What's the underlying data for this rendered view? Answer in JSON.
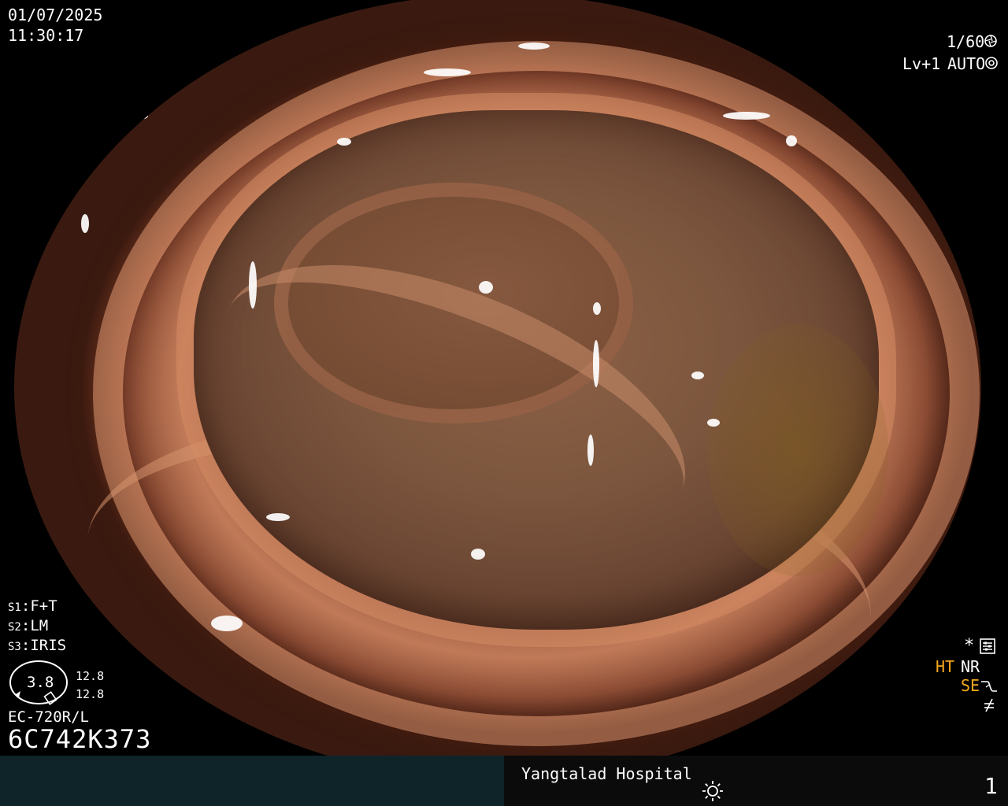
{
  "overlay": {
    "date": "01/07/2025",
    "time": "11:30:17",
    "shutter_speed": "1/60",
    "level": "Lv+1",
    "exposure_mode": "AUTO"
  },
  "scope_settings": {
    "s1": {
      "key": "S1",
      "value": "F+T"
    },
    "s2": {
      "key": "S2",
      "value": "LM"
    },
    "s3": {
      "key": "S3",
      "value": "IRIS"
    }
  },
  "scope": {
    "dial_value": "3.8",
    "zoom_top": "12.8",
    "zoom_bottom": "12.8",
    "model": "EC-720R/L",
    "serial": "6C742K373"
  },
  "status": {
    "asterisk": "*",
    "ht": "HT",
    "nr": "NR",
    "se": "SE",
    "ht_color": "#f4a81e",
    "se_color": "#f4a81e",
    "icons": [
      "settings-icon",
      "se-curve-icon",
      "flash-off-icon"
    ]
  },
  "footer": {
    "hospital": "Yangtalad Hospital",
    "image_count": "1",
    "left_panel_color": "#0e2429"
  }
}
